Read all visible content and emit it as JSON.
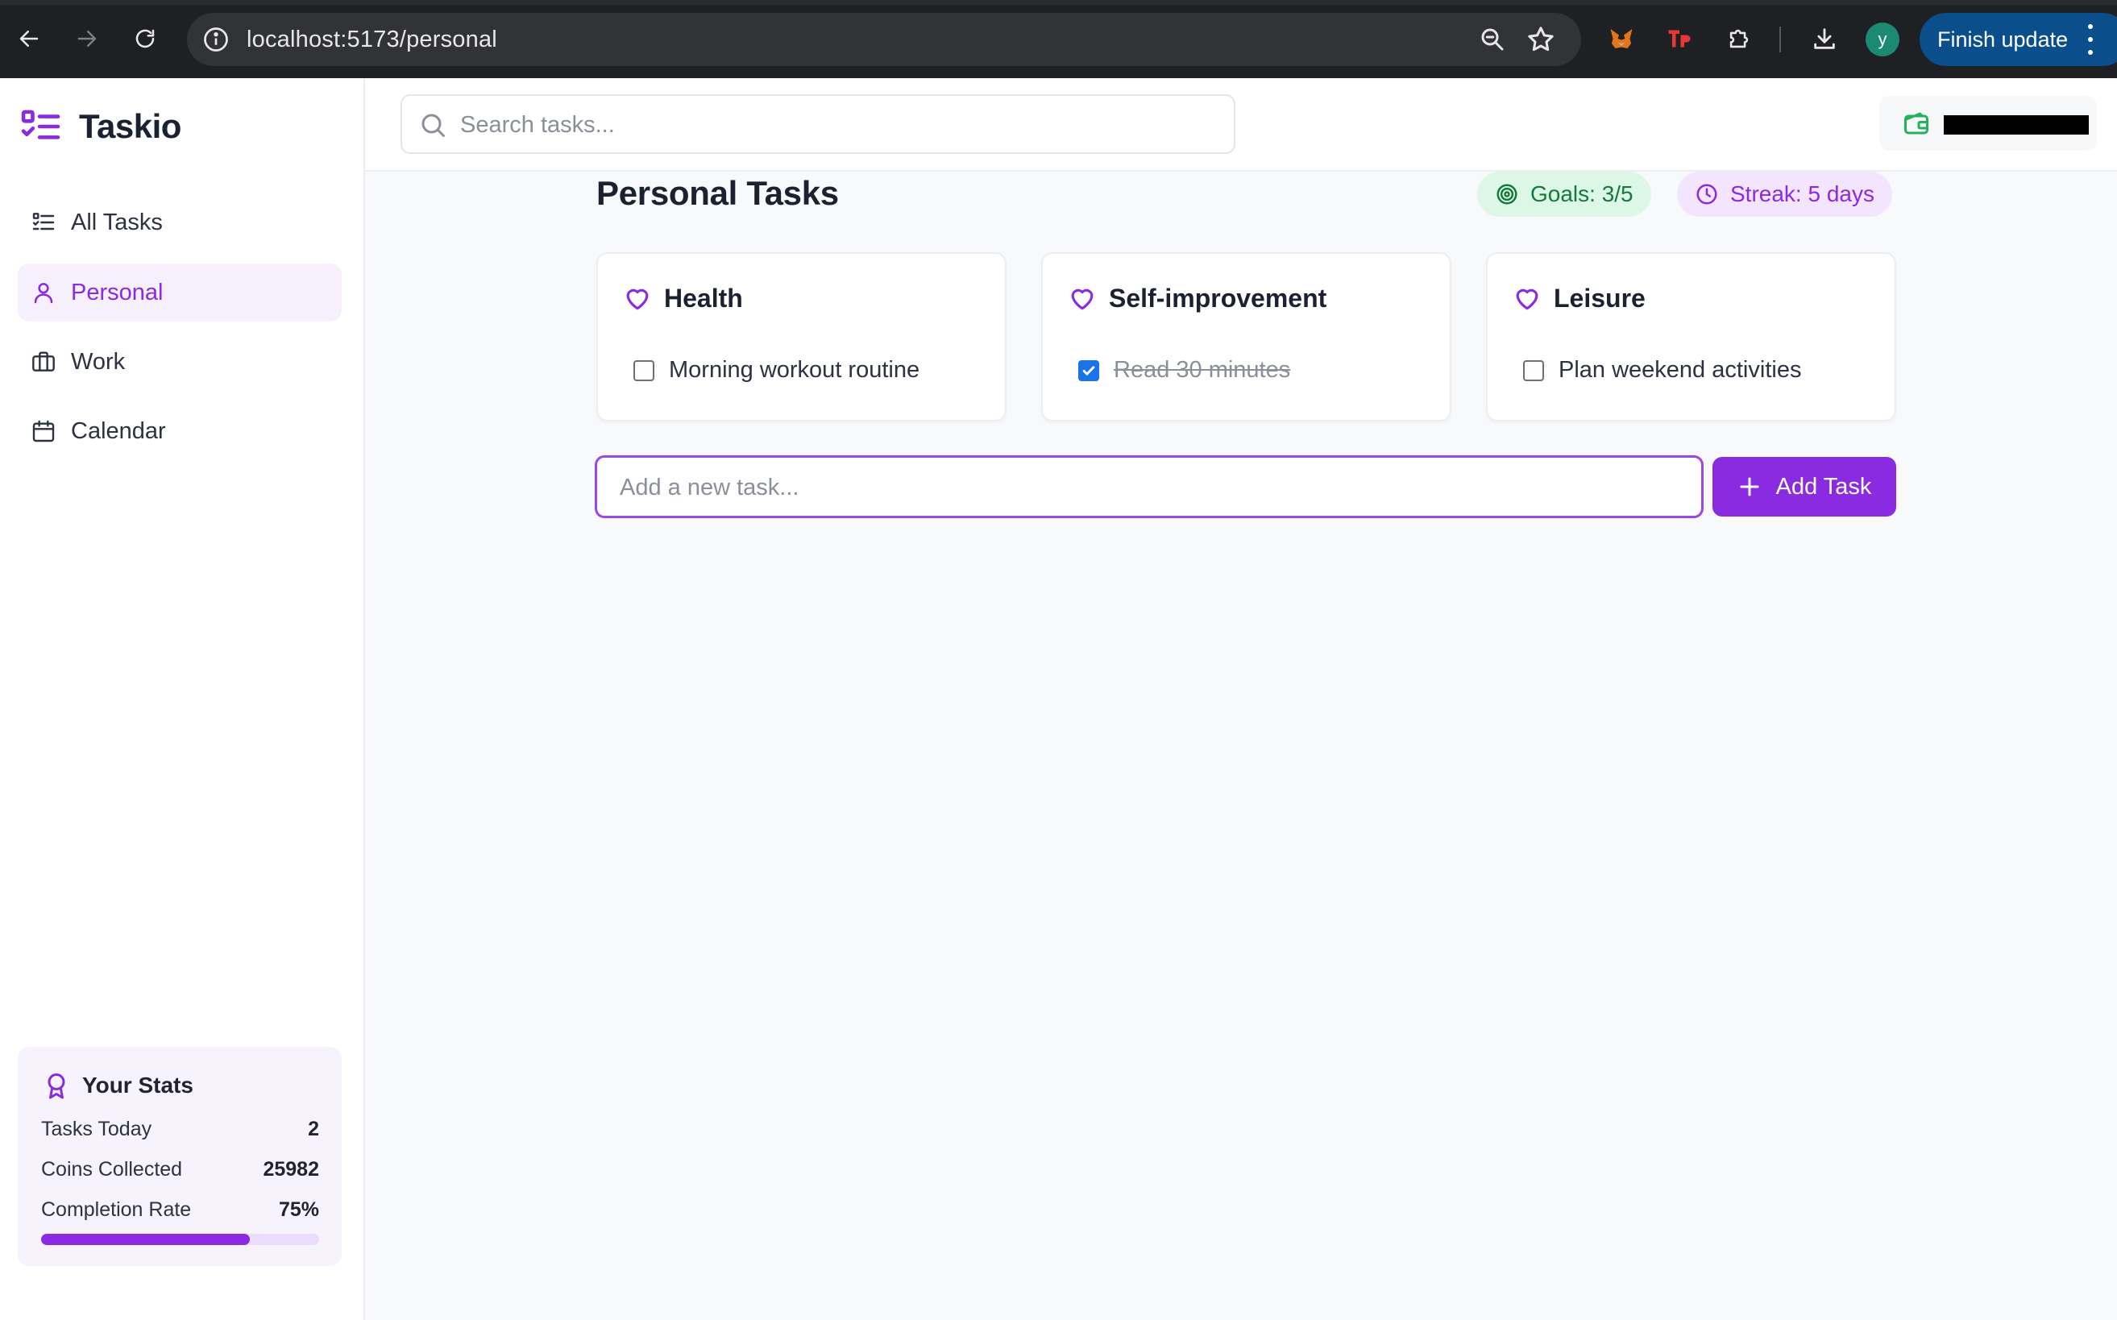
{
  "browser": {
    "url": "localhost:5173/personal",
    "profile_initial": "y",
    "finish_update_label": "Finish update"
  },
  "app": {
    "name": "Taskio",
    "accent": "#8a2be2"
  },
  "sidebar": {
    "items": [
      {
        "label": "All Tasks",
        "icon": "list-icon",
        "active": false
      },
      {
        "label": "Personal",
        "icon": "user-icon",
        "active": true
      },
      {
        "label": "Work",
        "icon": "briefcase-icon",
        "active": false
      },
      {
        "label": "Calendar",
        "icon": "calendar-icon",
        "active": false
      }
    ],
    "stats": {
      "title": "Your Stats",
      "rows": [
        {
          "label": "Tasks Today",
          "value": "2"
        },
        {
          "label": "Coins Collected",
          "value": "25982"
        },
        {
          "label": "Completion Rate",
          "value": "75%"
        }
      ],
      "completion_fraction": 0.75
    }
  },
  "header": {
    "search_placeholder": "Search tasks..."
  },
  "main": {
    "title": "Personal Tasks",
    "goals_badge": "Goals: 3/5",
    "streak_badge": "Streak: 5 days",
    "categories": [
      {
        "title": "Health",
        "task": "Morning workout routine",
        "done": false
      },
      {
        "title": "Self-improvement",
        "task": "Read 30 minutes",
        "done": true
      },
      {
        "title": "Leisure",
        "task": "Plan weekend activities",
        "done": false
      }
    ],
    "new_task_placeholder": "Add a new task...",
    "add_task_label": "Add Task"
  }
}
